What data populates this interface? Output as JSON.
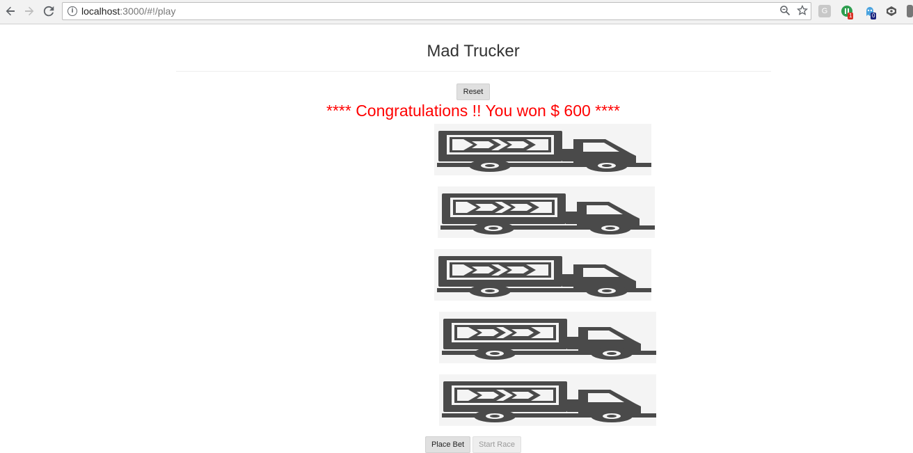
{
  "browser": {
    "url_host": "localhost",
    "url_rest": ":3000/#!/play",
    "ext_g_label": "G",
    "ext_badge_1": "1",
    "ext_badge_2": "0"
  },
  "page": {
    "title": "Mad Trucker",
    "reset_label": "Reset",
    "congrats": "**** Congratulations !! You won $ 600 ****",
    "place_bet_label": "Place Bet",
    "start_race_label": "Start Race"
  },
  "trucks": [
    {
      "name": "truck-1",
      "icon": "truck-icon"
    },
    {
      "name": "truck-2",
      "icon": "truck-icon"
    },
    {
      "name": "truck-3",
      "icon": "truck-icon"
    },
    {
      "name": "truck-4",
      "icon": "truck-icon"
    },
    {
      "name": "truck-5",
      "icon": "truck-icon"
    }
  ],
  "colors": {
    "congrats": "#ff0000",
    "truck": "#4a4a4a"
  }
}
